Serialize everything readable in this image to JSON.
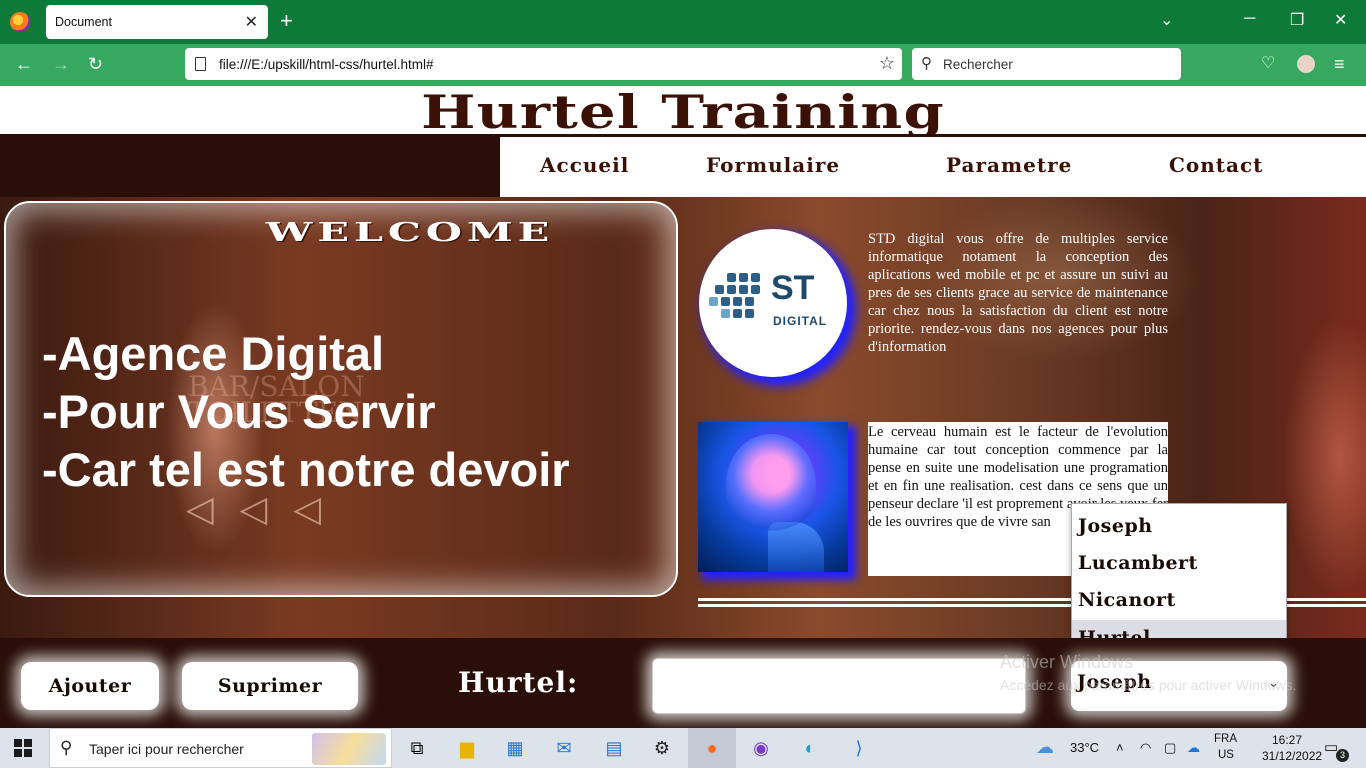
{
  "browser": {
    "tab_title": "Document",
    "url": "file:///E:/upskill/html-css/hurtel.html#",
    "search_placeholder": "Rechercher"
  },
  "page": {
    "site_title": "Hurtel Training",
    "menu": [
      "Accueil",
      "Formulaire",
      "Parametre",
      "Contact"
    ],
    "welcome": "WELCOME",
    "taglines": [
      "-Agence Digital",
      "-Pour Vous Servir",
      "-Car tel est notre devoir"
    ],
    "logo": {
      "brand": "ST",
      "sub": "DIGITAL"
    },
    "desc1": "STD digital vous offre de multiples service informatique notament la conception des aplications wed mobile et pc et assure un suivi au pres de ses clients grace au service de maintenance car chez nous la satisfaction du client est notre priorite. rendez-vous dans nos agences pour plus d'information",
    "desc2": "Le cerveau humain est le facteur de l'evolution humaine car tout conception commence par la pense en suite une modelisation une programation et en fin une realisation. cest dans ce sens que un penseur declare 'il est proprement avoir les yeux fer de les ouvrires que de vivre san",
    "dropdown": {
      "options": [
        "Joseph",
        "Lucambert",
        "Nicanort",
        "Hurtel"
      ],
      "selected_index": 3
    },
    "form": {
      "add_button": "Ajouter",
      "delete_button": "Suprimer",
      "label": "Hurtel:",
      "input_value": "",
      "select_value": "Joseph"
    },
    "watermark": {
      "line1": "Activer Windows",
      "line2": "Accédez aux paramètres pour activer Windows."
    }
  },
  "taskbar": {
    "search_placeholder": "Taper ici pour rechercher",
    "weather": "33°C",
    "lang_top": "FRA",
    "lang_bottom": "US",
    "time": "16:27",
    "date": "31/12/2022",
    "notifications": "3"
  },
  "colors": {
    "chrome_green": "#0d7a3a",
    "nav_green": "#36a860",
    "brown": "#3b1005",
    "taskbar": "#dde3ea"
  }
}
